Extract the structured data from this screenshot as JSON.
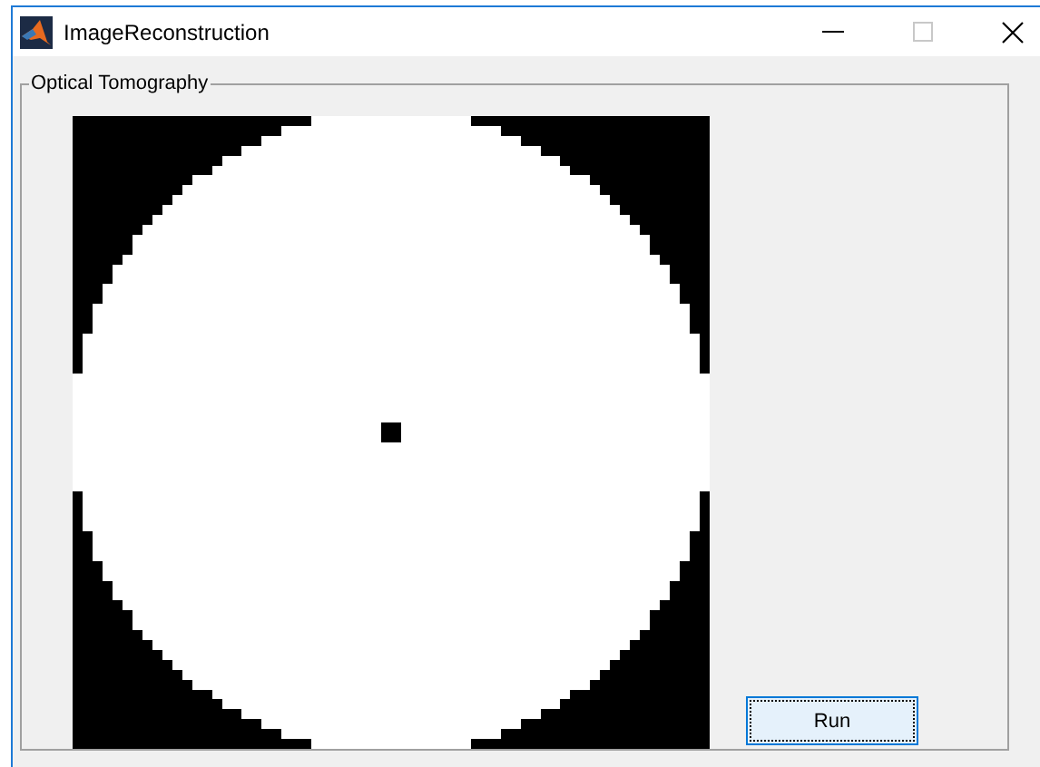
{
  "window": {
    "title": "ImageReconstruction"
  },
  "panel": {
    "title": "Optical Tomography"
  },
  "buttons": [
    {
      "label": "Run",
      "focused": true
    }
  ]
}
